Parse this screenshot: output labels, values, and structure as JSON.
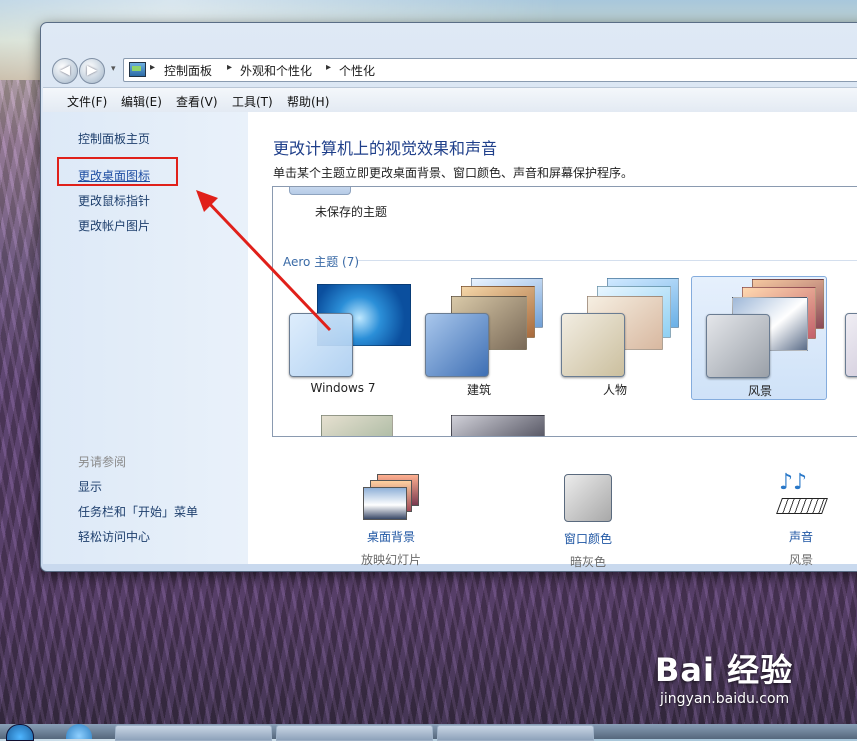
{
  "window": {
    "breadcrumb": [
      "控制面板",
      "外观和个性化",
      "个性化"
    ]
  },
  "menu": {
    "items": [
      "文件(F)",
      "编辑(E)",
      "查看(V)",
      "工具(T)",
      "帮助(H)"
    ]
  },
  "sidebar": {
    "home": "控制面板主页",
    "links": [
      "更改桌面图标",
      "更改鼠标指针",
      "更改帐户图片"
    ],
    "see_also_heading": "另请参阅",
    "see_also": [
      "显示",
      "任务栏和「开始」菜单",
      "轻松访问中心"
    ]
  },
  "main": {
    "title": "更改计算机上的视觉效果和声音",
    "description": "单击某个主题立即更改桌面背景、窗口颜色、声音和屏幕保护程序。",
    "unsaved_theme": "未保存的主题",
    "aero_group": "Aero 主题 (7)",
    "themes": [
      "Windows 7",
      "建筑",
      "人物",
      "风景"
    ],
    "selected_theme": "风景"
  },
  "bottom": {
    "wallpaper": {
      "label": "桌面背景",
      "value": "放映幻灯片"
    },
    "color": {
      "label": "窗口颜色",
      "value": "暗灰色"
    },
    "sound": {
      "label": "声音",
      "value": "风景"
    }
  },
  "watermark": {
    "brand": "Bai 经验",
    "url": "jingyan.baidu.com"
  },
  "colors": {
    "highlight": "#e0201a",
    "link": "#1f56a3",
    "title": "#1f3f8a"
  }
}
